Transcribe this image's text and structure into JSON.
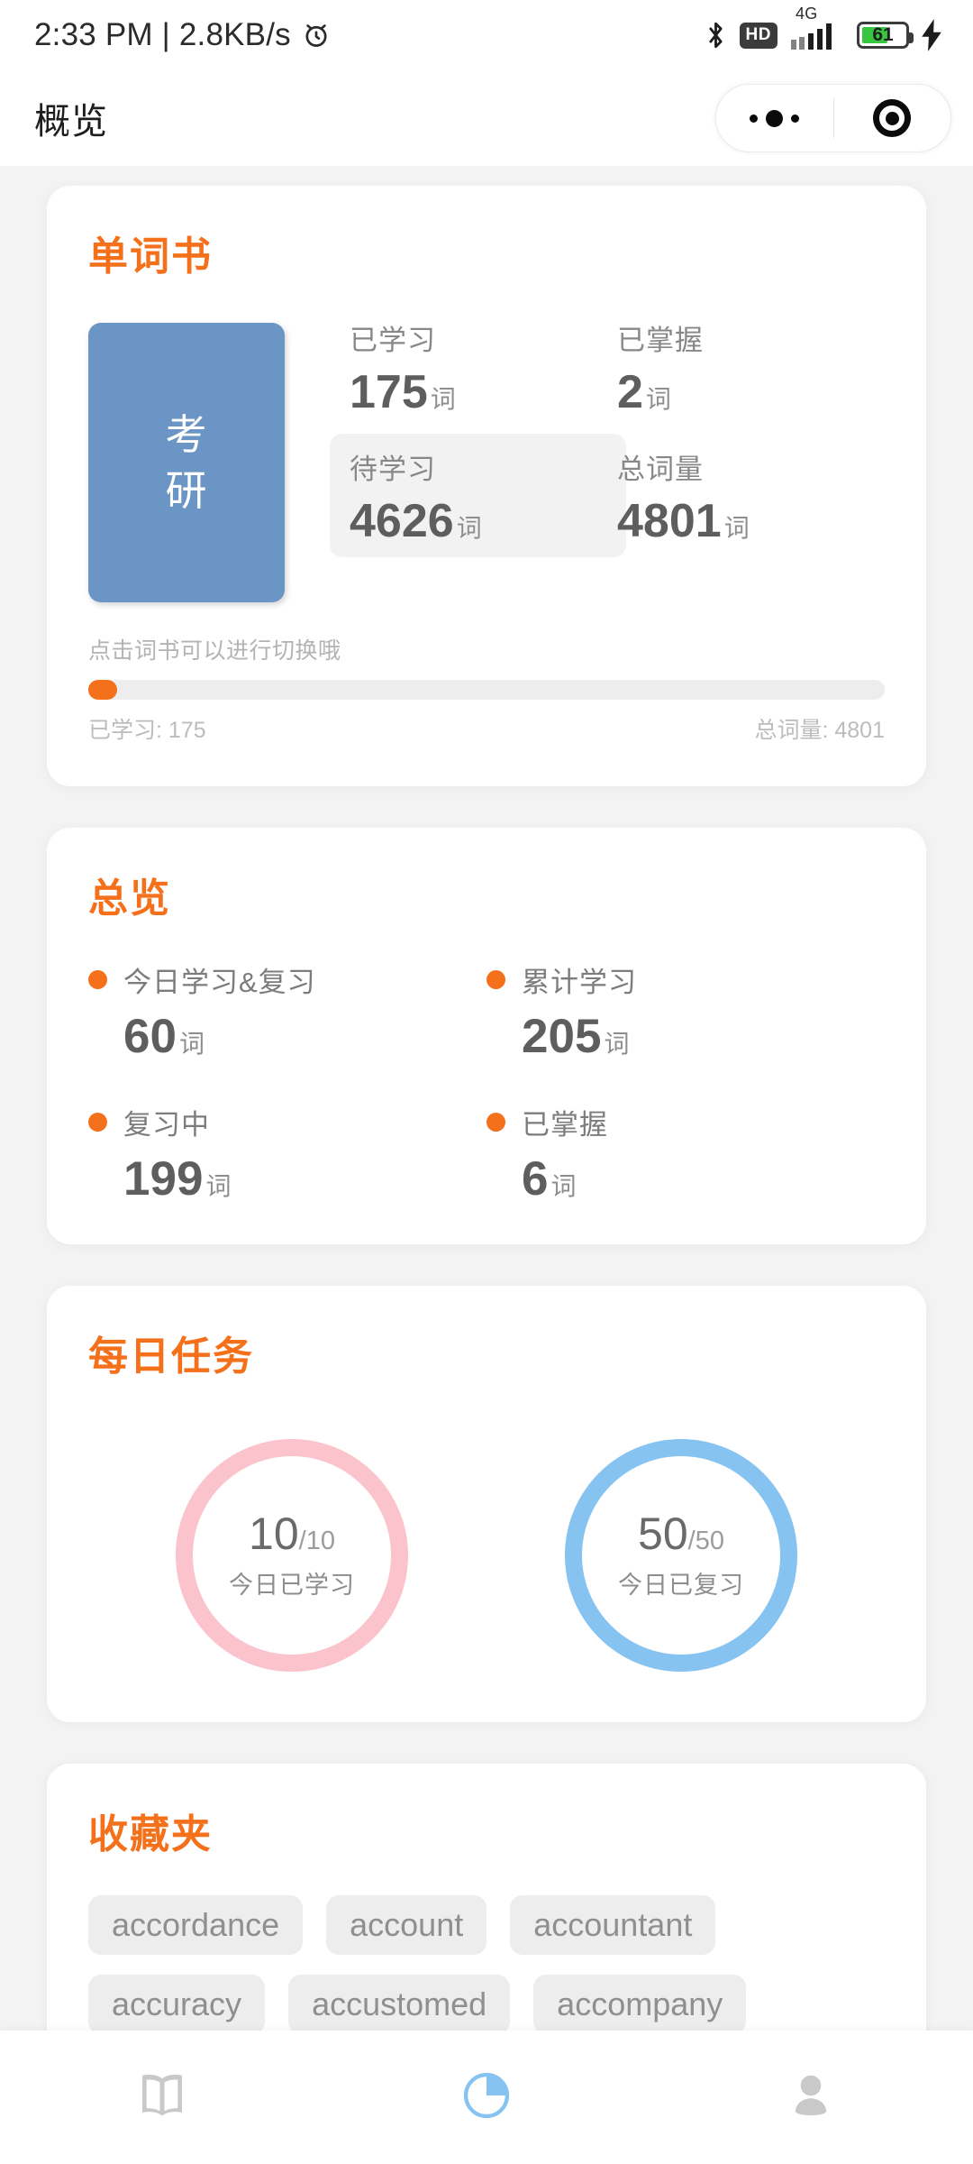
{
  "status_bar": {
    "time_and_net": "2:33 PM | 2.8KB/s",
    "alarm_icon": "alarm-clock-icon",
    "bluetooth_icon": "bluetooth-icon",
    "hd_label": "HD",
    "network_type": "4G",
    "signal_icon": "signal-bars-icon",
    "battery_level": "61",
    "battery_percent": 61,
    "charging_icon": "lightning-bolt-icon"
  },
  "nav": {
    "title": "概览",
    "capsule": {
      "menu_icon": "three-dots-icon",
      "target_icon": "target-circle-icon"
    }
  },
  "wordbook": {
    "title": "单词书",
    "book_cover": {
      "line1": "考",
      "line2": "研",
      "color": "#6b95c4"
    },
    "stats": [
      {
        "label": "已学习",
        "value": "175",
        "unit": "词",
        "highlighted": false
      },
      {
        "label": "已掌握",
        "value": "2",
        "unit": "词",
        "highlighted": false
      },
      {
        "label": "待学习",
        "value": "4626",
        "unit": "词",
        "highlighted": true
      },
      {
        "label": "总词量",
        "value": "4801",
        "unit": "词",
        "highlighted": false
      }
    ],
    "hint": "点击词书可以进行切换哦",
    "progress": {
      "percent": 3.6,
      "left_label": "已学习: 175",
      "right_label": "总词量: 4801",
      "fill_color": "#f4701a"
    }
  },
  "overview": {
    "title": "总览",
    "items": [
      {
        "label": "今日学习&复习",
        "value": "60",
        "unit": "词"
      },
      {
        "label": "累计学习",
        "value": "205",
        "unit": "词"
      },
      {
        "label": "复习中",
        "value": "199",
        "unit": "词"
      },
      {
        "label": "已掌握",
        "value": "6",
        "unit": "词"
      }
    ],
    "bullet_color": "#f4701a"
  },
  "daily_tasks": {
    "title": "每日任务",
    "rings": [
      {
        "current": "10",
        "total": "/10",
        "caption": "今日已学习",
        "color": "#fbc3cb",
        "percent": 100
      },
      {
        "current": "50",
        "total": "/50",
        "caption": "今日已复习",
        "color": "#86c3f0",
        "percent": 100
      }
    ]
  },
  "favorites": {
    "title": "收藏夹",
    "words": [
      "accordance",
      "account",
      "accountant",
      "accuracy",
      "accustomed",
      "accompany"
    ]
  },
  "tabbar": {
    "tabs": [
      {
        "name": "book-tab",
        "icon": "open-book-icon",
        "active": false
      },
      {
        "name": "stats-tab",
        "icon": "pie-chart-icon",
        "active": true
      },
      {
        "name": "profile-tab",
        "icon": "person-avatar-icon",
        "active": false
      }
    ],
    "active_color": "#86c3f0",
    "inactive_color": "#c9c9c9"
  },
  "theme": {
    "accent": "#f4701a",
    "page_bg": "#f3f3f3",
    "card_bg": "#ffffff"
  }
}
